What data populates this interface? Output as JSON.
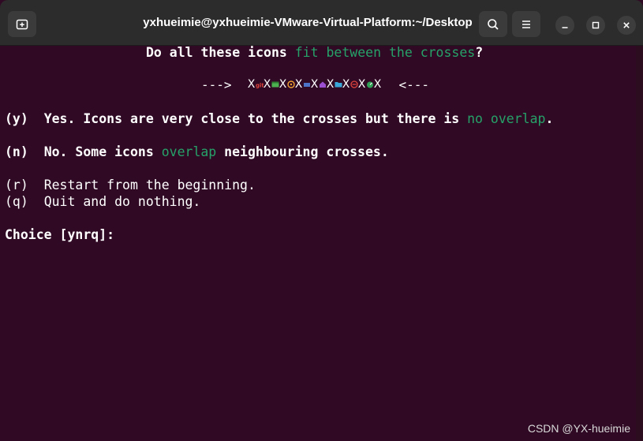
{
  "window": {
    "title": "yxhueimie@yxhueimie-VMware-Virtual-Platform:~/Desktop",
    "buttons": {
      "new_tab_icon": "new-tab-icon",
      "search_icon": "search-icon",
      "menu_icon": "hamburger-menu-icon",
      "minimize_icon": "minimize-icon",
      "maximize_icon": "maximize-icon",
      "close_icon": "close-icon"
    }
  },
  "terminal": {
    "question_pre": "Do all these icons ",
    "question_hl": "fit between the crosses",
    "question_post": "?",
    "arrow_left": "--->",
    "arrow_right": "<---",
    "cross_char": "X",
    "icons": [
      "git-icon",
      "window-icon",
      "clock-icon",
      "folder-icon",
      "home-icon",
      "folder-open-icon",
      "minus-circle-icon",
      "gauge-icon"
    ],
    "option_y_key": "(y)",
    "option_y_pre": "Yes. Icons are very close to the crosses but there is ",
    "option_y_hl": "no overlap",
    "option_y_post": ".",
    "option_n_key": "(n)",
    "option_n_pre": "No. Some icons ",
    "option_n_hl": "overlap",
    "option_n_post": " neighbouring crosses.",
    "option_r_key": "(r)",
    "option_r_text": "Restart from the beginning.",
    "option_q_key": "(q)",
    "option_q_text": "Quit and do nothing.",
    "prompt": "Choice [ynrq]:"
  },
  "watermark": "CSDN @YX-hueimie",
  "colors": {
    "terminal_bg": "#300a24",
    "highlight": "#26a269",
    "titlebar_bg": "#2c2c2c"
  }
}
